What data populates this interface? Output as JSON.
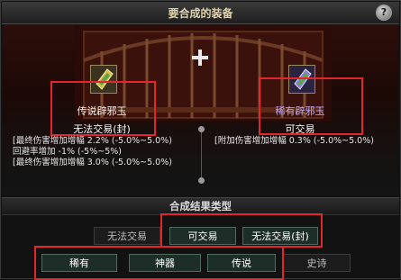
{
  "window": {
    "title": "要合成的装备",
    "help_label": "?"
  },
  "left_item": {
    "name": "传说辟邪玉",
    "trade_status": "无法交易(封)",
    "stats": [
      "[最终伤害增加增幅 2.2% (-5.0%~5.0%)",
      "   回避率增加 -1% (-5%~5%)",
      "[最终伤害增加增幅 3.0% (-5.0%~5.0%)"
    ]
  },
  "right_item": {
    "name": "稀有辟邪玉",
    "trade_status": "可交易",
    "stats": [
      "[附加伤害增加增幅 0.3% (-5.0%~5.0%)"
    ]
  },
  "result_section": {
    "title": "合成结果类型",
    "trade_options": [
      "无法交易",
      "可交易",
      "无法交易(封)"
    ],
    "rarity_options": [
      "稀有",
      "神器",
      "传说",
      "史诗"
    ]
  },
  "colors": {
    "highlight_box": "#e1272b",
    "rare": "#7aa8ff",
    "artifact": "#e74cff",
    "legendary": "#ffd54a",
    "right_item_name": "#bfa8ff"
  },
  "icons": [
    "help-icon",
    "plus-icon",
    "jade-amulet-icon"
  ]
}
